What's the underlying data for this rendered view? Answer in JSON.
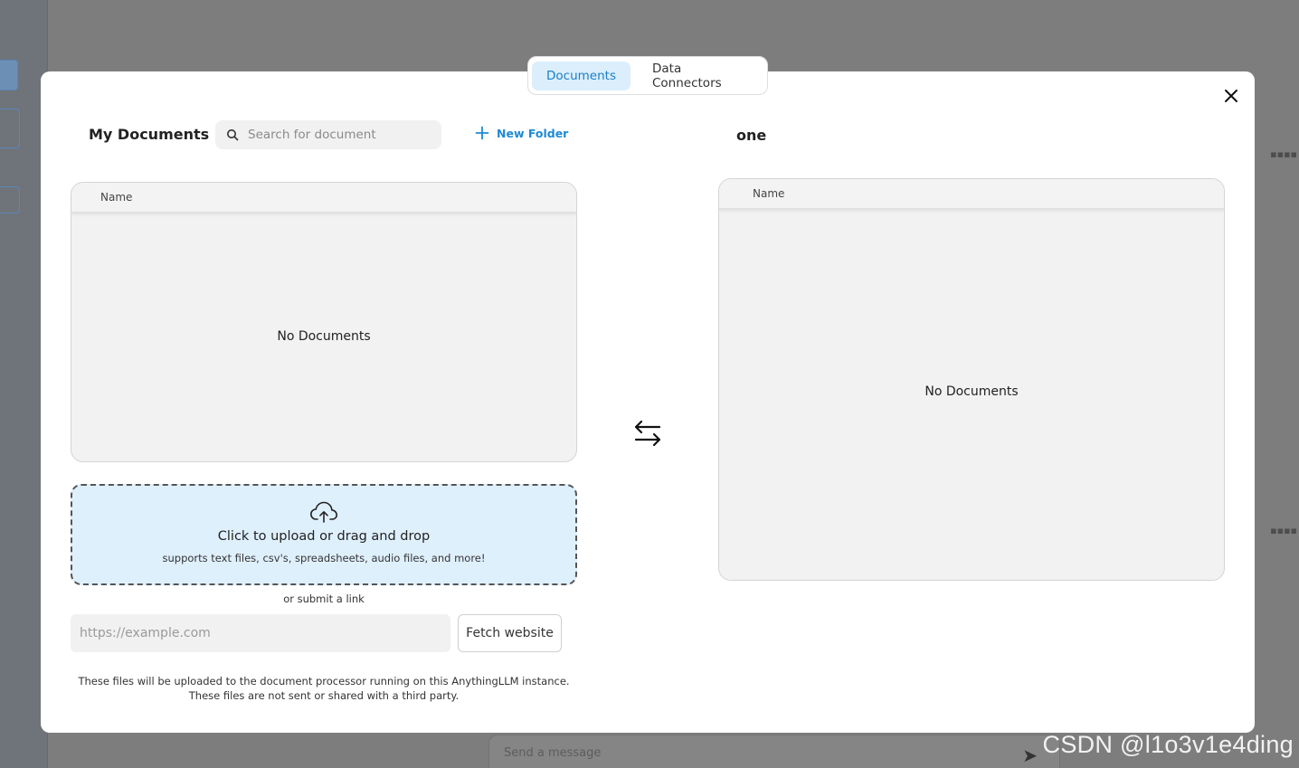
{
  "tabs": [
    {
      "label": "Documents",
      "active": true
    },
    {
      "label": "Data Connectors",
      "active": false
    }
  ],
  "left": {
    "title": "My Documents",
    "search_placeholder": "Search for document",
    "new_folder_label": "New Folder",
    "column_name": "Name",
    "empty_text": "No Documents"
  },
  "right": {
    "title": "one",
    "column_name": "Name",
    "empty_text": "No Documents"
  },
  "upload": {
    "main_text": "Click to upload or drag and drop",
    "sub_text": "supports text files, csv's, spreadsheets, audio files, and more!"
  },
  "link": {
    "or_text": "or submit a link",
    "placeholder": "https://example.com",
    "fetch_label": "Fetch website"
  },
  "disclaimer": {
    "line1": "These files will be uploaded to the document processor running on this AnythingLLM instance.",
    "line2": "These files are not sent or shared with a third party."
  },
  "background": {
    "chat_placeholder": "Send a message"
  },
  "watermark": "CSDN @l1o3v1e4ding",
  "colors": {
    "accent": "#1d8ad4",
    "tab_active_bg": "#dbeefc",
    "upload_bg": "#dff0fd"
  }
}
